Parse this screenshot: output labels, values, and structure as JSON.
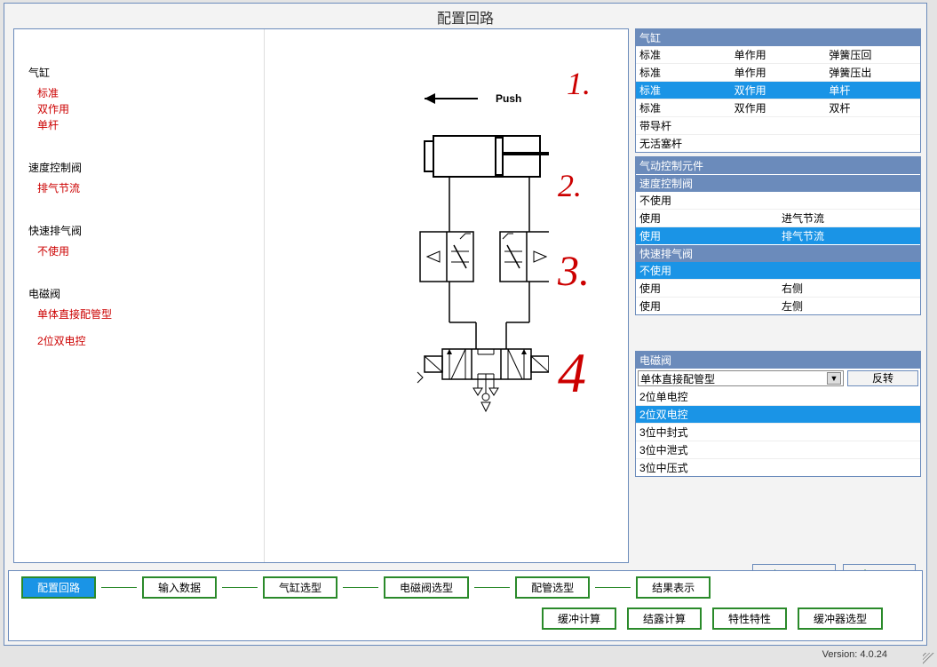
{
  "title": "配置回路",
  "left": {
    "cylinder": {
      "title": "气缸",
      "v1": "标准",
      "v2": "双作用",
      "v3": "单杆"
    },
    "speed": {
      "title": "速度控制阀",
      "v1": "排气节流"
    },
    "quick": {
      "title": "快速排气阀",
      "v1": "不使用"
    },
    "sol": {
      "title": "电磁阀",
      "v1": "单体直接配管型",
      "v2": "2位双电控"
    }
  },
  "diagram": {
    "push": "Push"
  },
  "annotations": {
    "one": "1.",
    "two": "2.",
    "three": "3.",
    "four": "4"
  },
  "panels": {
    "cylinder": {
      "header": "气缸",
      "rows": [
        {
          "c1": "标准",
          "c2": "单作用",
          "c3": "弹簧压回",
          "sel": false
        },
        {
          "c1": "标准",
          "c2": "单作用",
          "c3": "弹簧压出",
          "sel": false
        },
        {
          "c1": "标准",
          "c2": "双作用",
          "c3": "单杆",
          "sel": true
        },
        {
          "c1": "标准",
          "c2": "双作用",
          "c3": "双杆",
          "sel": false
        },
        {
          "c1": "带导杆",
          "c2": "",
          "c3": "",
          "sel": false
        },
        {
          "c1": "无活塞杆",
          "c2": "",
          "c3": "",
          "sel": false
        }
      ]
    },
    "pneumatic": {
      "header": "气动控制元件",
      "speed": {
        "header": "速度控制阀",
        "rows": [
          {
            "c1": "不使用",
            "c2": "",
            "sel": false
          },
          {
            "c1": "使用",
            "c2": "进气节流",
            "sel": false
          },
          {
            "c1": "使用",
            "c2": "排气节流",
            "sel": true
          }
        ]
      },
      "quick": {
        "header": "快速排气阀",
        "rows": [
          {
            "c1": "不使用",
            "c2": "",
            "sel": true
          },
          {
            "c1": "使用",
            "c2": "右侧",
            "sel": false
          },
          {
            "c1": "使用",
            "c2": "左侧",
            "sel": false
          }
        ]
      }
    },
    "solenoid": {
      "header": "电磁阀",
      "dropdown": "单体直接配管型",
      "invert": "反转",
      "rows": [
        {
          "c1": "2位单电控",
          "sel": false
        },
        {
          "c1": "2位双电控",
          "sel": true
        },
        {
          "c1": "3位中封式",
          "sel": false
        },
        {
          "c1": "3位中泄式",
          "sel": false
        },
        {
          "c1": "3位中压式",
          "sel": false
        }
      ]
    }
  },
  "buttons": {
    "next": "下一步",
    "cancel": "取消"
  },
  "flow": {
    "row1": [
      "配置回路",
      "输入数据",
      "气缸选型",
      "电磁阀选型",
      "配管选型",
      "结果表示"
    ],
    "row2": [
      "缓冲计算",
      "结露计算",
      "特性特性",
      "缓冲器选型"
    ]
  },
  "version": "Version: 4.0.24"
}
